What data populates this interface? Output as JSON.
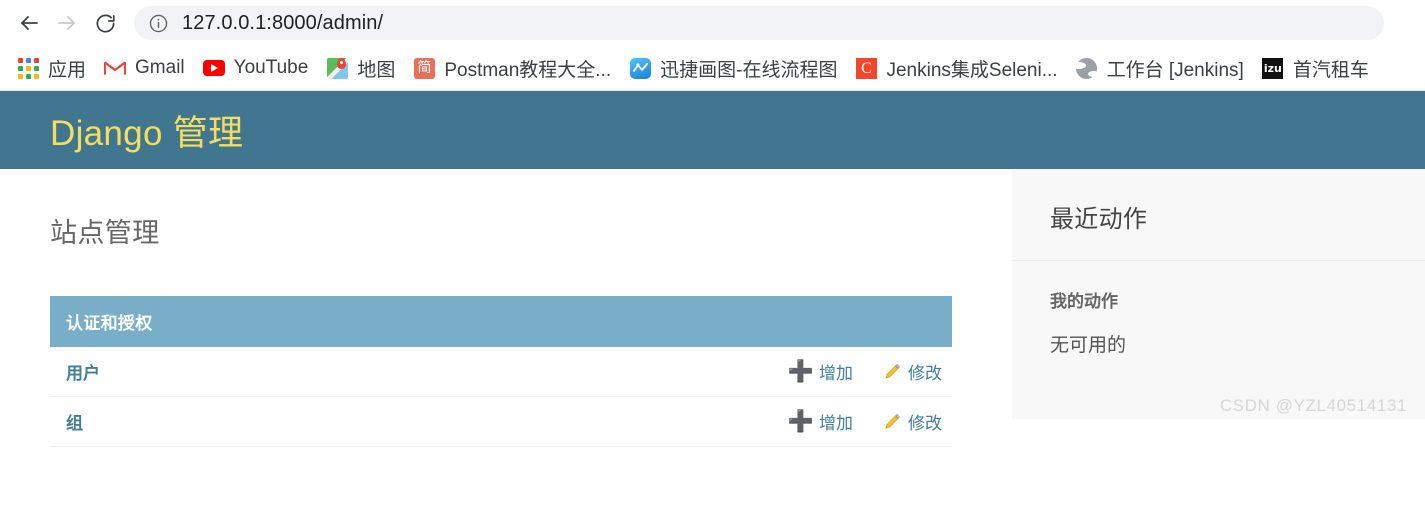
{
  "browser": {
    "nav": {
      "back_icon": "arrow-left-icon",
      "forward_icon": "arrow-right-icon",
      "reload_icon": "reload-icon"
    },
    "omnibox": {
      "info_icon": "site-info-icon",
      "url_host": "127.0.0.1:8000",
      "url_path": "/admin/",
      "url_full": "127.0.0.1:8000/admin/"
    },
    "bookmarks": [
      {
        "label": "应用",
        "icon": "apps-grid-icon"
      },
      {
        "label": "Gmail",
        "icon": "gmail-icon"
      },
      {
        "label": "YouTube",
        "icon": "youtube-icon"
      },
      {
        "label": "地图",
        "icon": "google-maps-icon"
      },
      {
        "label": "Postman教程大全...",
        "icon": "jianshu-icon"
      },
      {
        "label": "迅捷画图-在线流程图",
        "icon": "xunjie-chart-icon"
      },
      {
        "label": "Jenkins集成Seleni...",
        "icon": "csdn-c-icon"
      },
      {
        "label": "工作台 [Jenkins]",
        "icon": "globe-icon"
      },
      {
        "label": "首汽租车",
        "icon": "izu-icon"
      }
    ]
  },
  "django": {
    "branding": "Django 管理",
    "page_title": "站点管理",
    "app": {
      "caption": "认证和授权",
      "models": [
        {
          "name": "用户",
          "add_label": "增加",
          "add_icon": "plus-icon",
          "change_label": "修改",
          "change_icon": "pencil-icon"
        },
        {
          "name": "组",
          "add_label": "增加",
          "add_icon": "plus-icon",
          "change_label": "修改",
          "change_icon": "pencil-icon"
        }
      ]
    },
    "sidebar": {
      "title": "最近动作",
      "subtitle": "我的动作",
      "empty_text": "无可用的"
    }
  },
  "watermark": "CSDN @YZL40514131",
  "colors": {
    "header_bg": "#417690",
    "branding_text": "#f5dd5d",
    "module_caption_bg": "#79aec8",
    "link": "#447e9b",
    "add_green": "#70bf2b",
    "pencil_yellow": "#efb80b",
    "sidebar_bg": "#f8f8f8"
  }
}
